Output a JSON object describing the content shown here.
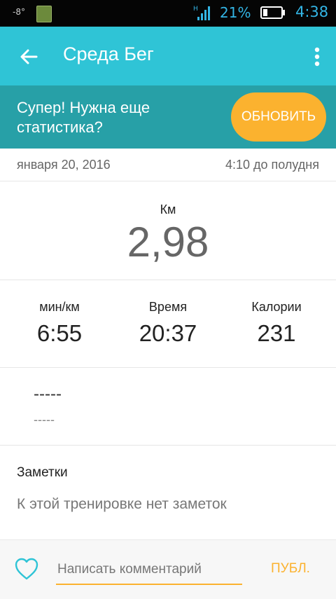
{
  "status_bar": {
    "temperature": "-8°",
    "network": "H",
    "battery_percent": "21%",
    "time": "4:38",
    "colors": {
      "background": "#050505",
      "icons": "#33b5e5"
    },
    "icons": [
      "weather-app-icon",
      "signal-icon",
      "battery-icon"
    ]
  },
  "app_bar": {
    "title": "Среда Бег",
    "back_icon": "arrow-left-icon",
    "menu_icon": "more-vertical-icon",
    "color": "#2fc4d6"
  },
  "upsell": {
    "text": "Супер! Нужна еще статистика?",
    "button_label": "ОБНОВИТЬ",
    "background": "#27a0a7",
    "button_color": "#fbb22f"
  },
  "workout_meta": {
    "date": "января 20, 2016",
    "time": "4:10 до полудня"
  },
  "distance": {
    "unit": "Км",
    "value": "2,98"
  },
  "stats": [
    {
      "label": "мин/км",
      "value": "6:55"
    },
    {
      "label": "Время",
      "value": "20:37"
    },
    {
      "label": "Калории",
      "value": "231"
    }
  ],
  "extra": {
    "primary": "-----",
    "secondary": "-----"
  },
  "notes": {
    "title": "Заметки",
    "empty_text": "К этой тренировке нет заметок"
  },
  "comment_bar": {
    "heart_icon": "heart-outline-icon",
    "placeholder": "Написать комментарий",
    "value": "",
    "publish_label": "ПУБЛ.",
    "accent": "#fbb22f"
  }
}
